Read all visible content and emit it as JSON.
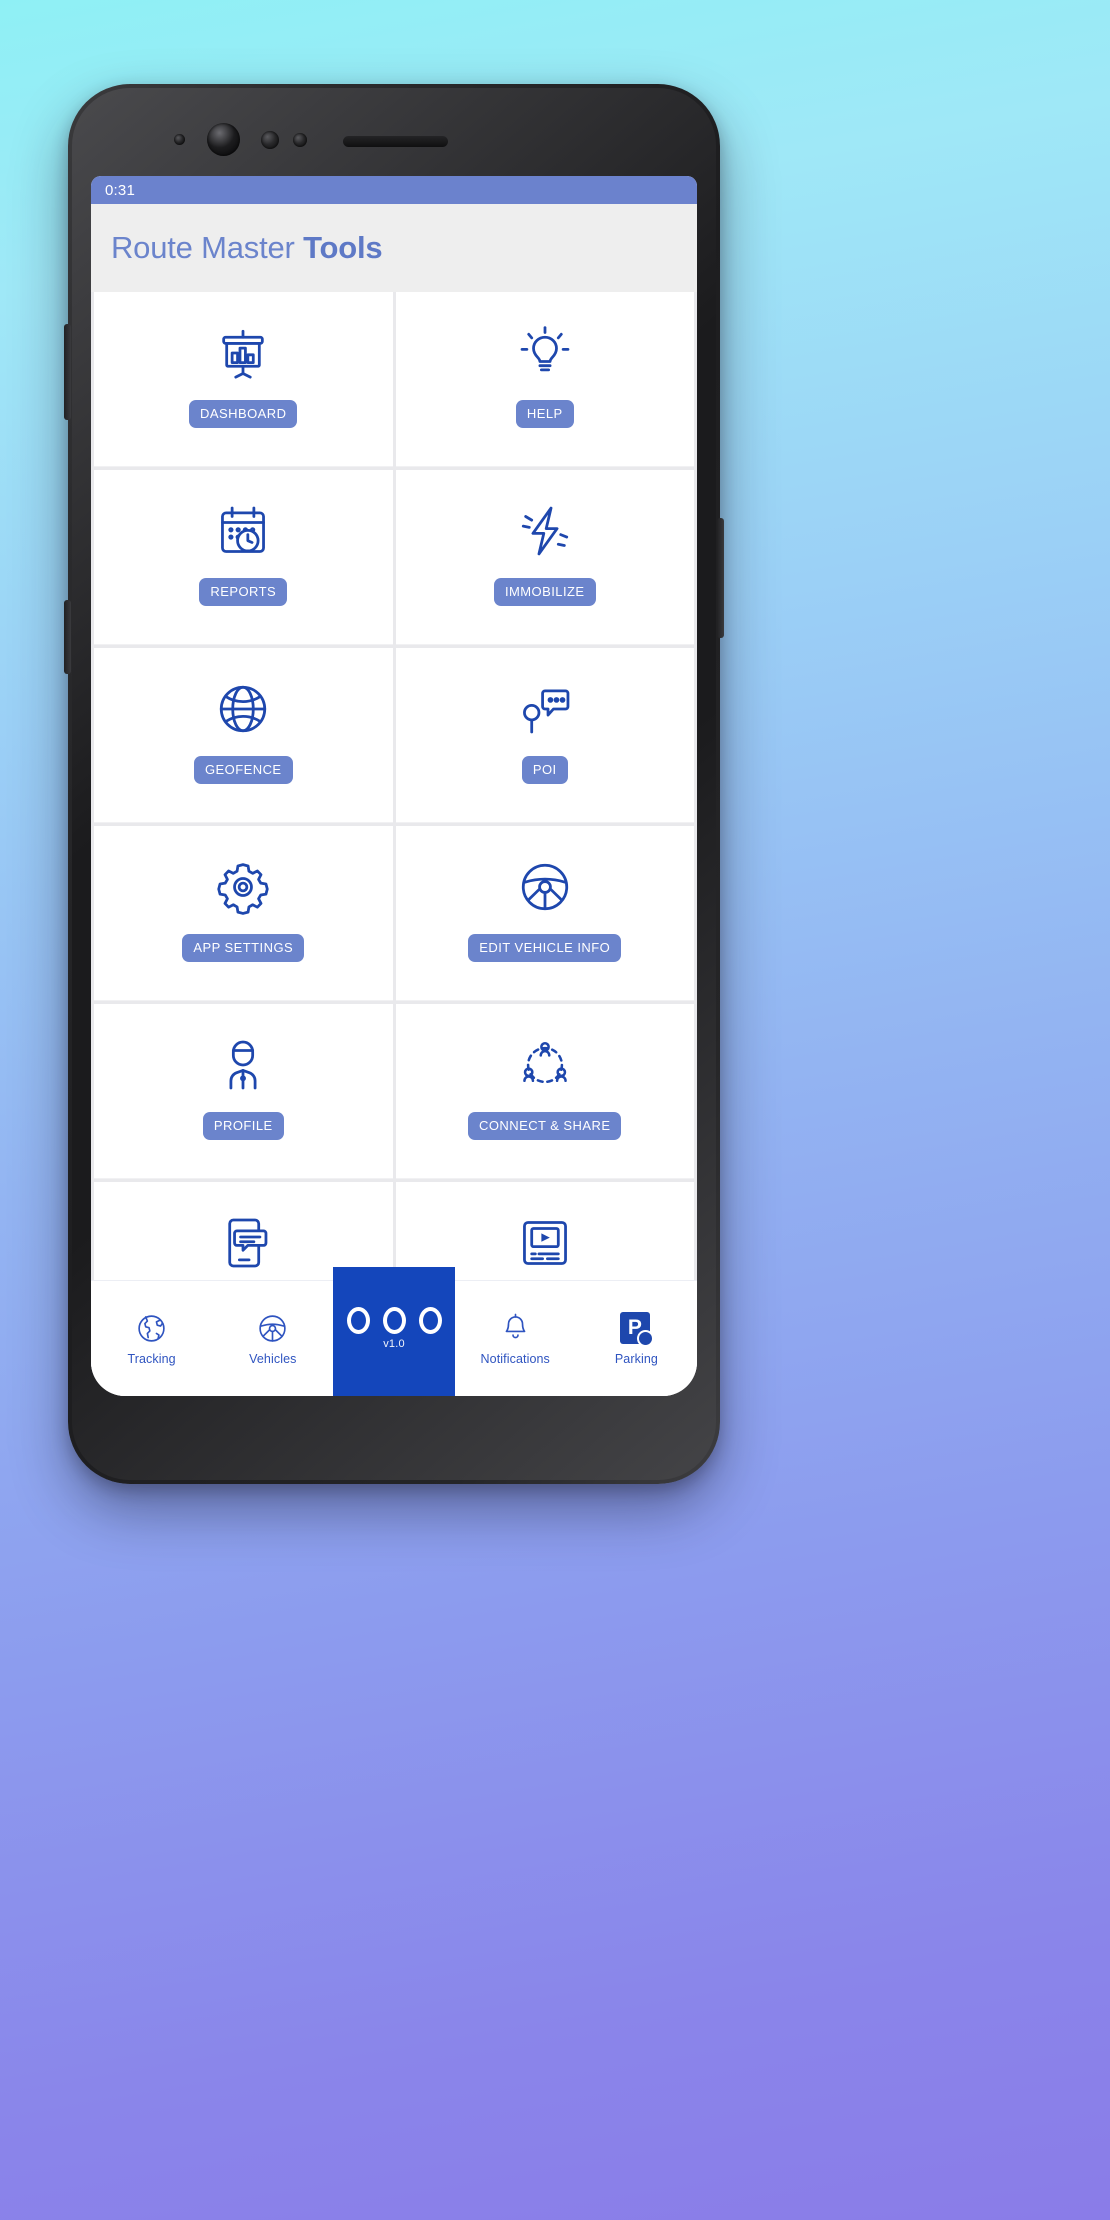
{
  "status_bar": {
    "time": "0:31"
  },
  "header": {
    "title_light": "Route Master",
    "title_bold": "Tools"
  },
  "colors": {
    "status_bar": "#6b82cd",
    "header_bg": "#eeeeee",
    "title": "#6b84cc",
    "badge_bg": "#6b84cc",
    "icon": "#1e47ad",
    "nav_center_bg": "#1446bb",
    "nav_text": "#2f54c0",
    "grid_bg": "#e9e9ec"
  },
  "grid": {
    "tiles": [
      {
        "label": "DASHBOARD",
        "icon": "presentation-chart-icon"
      },
      {
        "label": "HELP",
        "icon": "lightbulb-icon"
      },
      {
        "label": "REPORTS",
        "icon": "calendar-clock-icon"
      },
      {
        "label": "IMMOBILIZE",
        "icon": "lightning-bolt-icon"
      },
      {
        "label": "GEOFENCE",
        "icon": "globe-grid-icon"
      },
      {
        "label": "POI",
        "icon": "map-pin-chat-icon"
      },
      {
        "label": "APP SETTINGS",
        "icon": "gear-icon"
      },
      {
        "label": "EDIT VEHICLE INFO",
        "icon": "steering-wheel-icon"
      },
      {
        "label": "PROFILE",
        "icon": "user-profile-icon"
      },
      {
        "label": "CONNECT & SHARE",
        "icon": "connect-share-icon"
      },
      {
        "label": "",
        "icon": "phone-message-icon"
      },
      {
        "label": "",
        "icon": "video-player-icon"
      }
    ]
  },
  "bottom_nav": {
    "items": [
      {
        "label": "Tracking",
        "icon": "globe-icon"
      },
      {
        "label": "Vehicles",
        "icon": "steering-wheel-icon"
      },
      {
        "label": "",
        "icon": "three-circles-icon",
        "version": "v1.0",
        "active": true
      },
      {
        "label": "Notifications",
        "icon": "bell-icon"
      },
      {
        "label": "Parking",
        "icon": "parking-icon"
      }
    ]
  }
}
